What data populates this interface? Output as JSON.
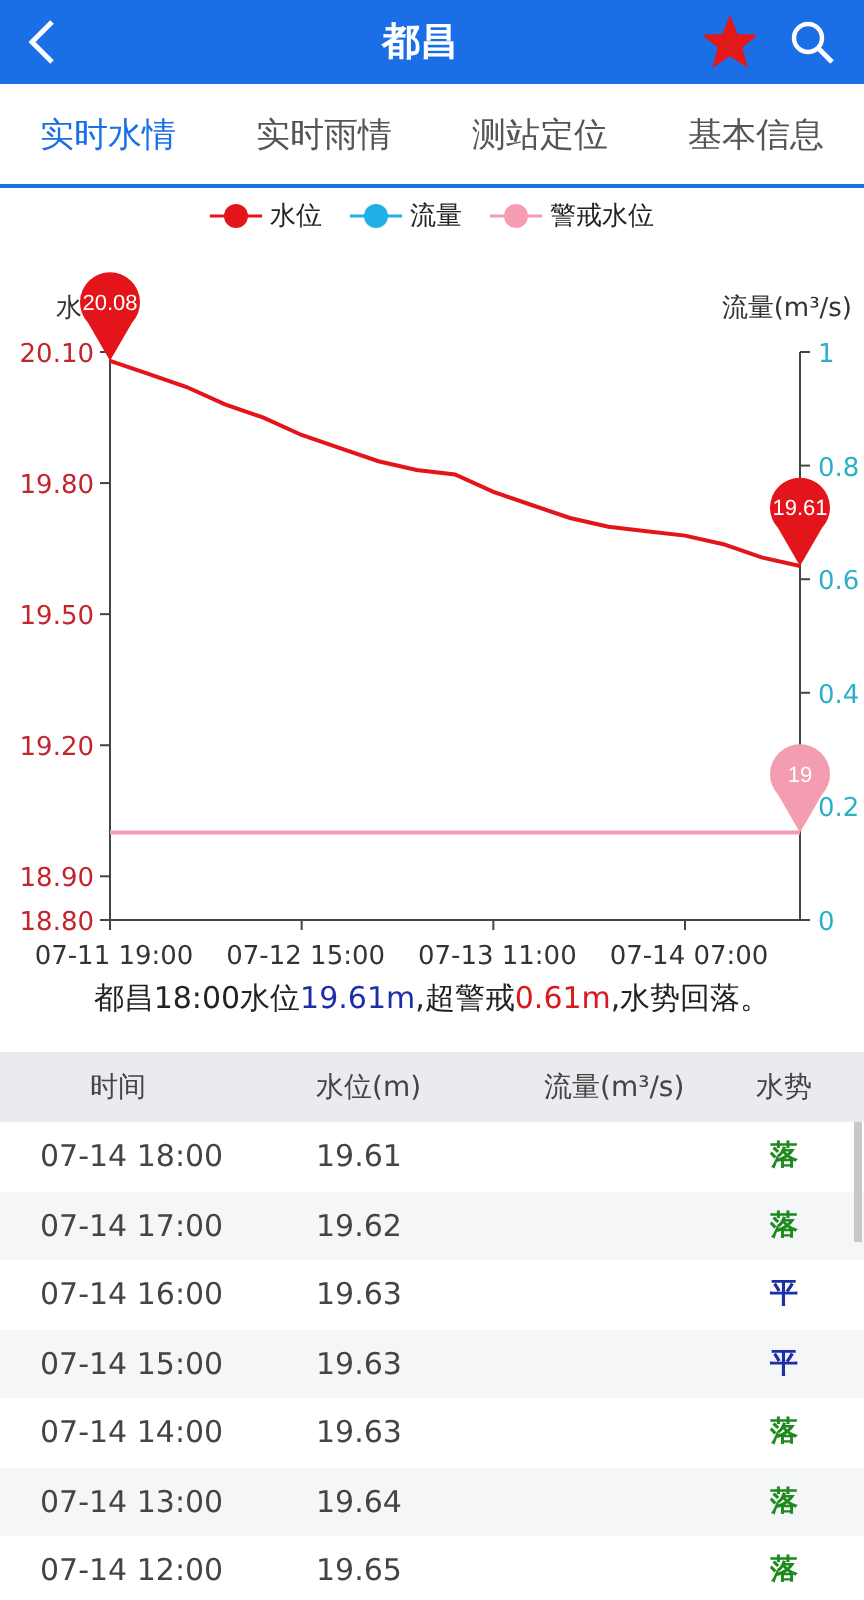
{
  "header": {
    "title": "都昌",
    "favorite": true
  },
  "tabs": [
    {
      "label": "实时水情",
      "selected": true
    },
    {
      "label": "实时雨情",
      "selected": false
    },
    {
      "label": "测站定位",
      "selected": false
    },
    {
      "label": "基本信息",
      "selected": false
    }
  ],
  "chart": {
    "chart_data": {
      "type": "line",
      "ylabel": "水",
      "y2label": "流量(m³/s)",
      "categories": [
        "07-11 19:00",
        null,
        null,
        null,
        null,
        "07-12 15:00",
        null,
        null,
        null,
        null,
        "07-13 11:00",
        null,
        null,
        null,
        null,
        "07-14 07:00",
        null,
        null,
        null
      ],
      "ylim": [
        18.8,
        20.1
      ],
      "y2lim": [
        0,
        1
      ],
      "yticks": [
        {
          "value": 20.1,
          "label": "20.10"
        },
        {
          "value": 19.8,
          "label": "19.80"
        },
        {
          "value": 19.5,
          "label": "19.50"
        },
        {
          "value": 19.2,
          "label": "19.20"
        },
        {
          "value": 18.9,
          "label": "18.90"
        },
        {
          "value": 18.8,
          "label": "18.80"
        }
      ],
      "y2ticks": [
        {
          "value": 1,
          "label": "1"
        },
        {
          "value": 0.8,
          "label": "0.8"
        },
        {
          "value": 0.6,
          "label": "0.6"
        },
        {
          "value": 0.4,
          "label": "0.4"
        },
        {
          "value": 0.2,
          "label": "0.2"
        },
        {
          "value": 0,
          "label": "0"
        }
      ],
      "series": [
        {
          "name": "水位",
          "color": "#e3151b",
          "values": [
            20.08,
            20.05,
            20.02,
            19.98,
            19.95,
            19.91,
            19.88,
            19.85,
            19.83,
            19.82,
            19.78,
            19.75,
            19.72,
            19.7,
            19.69,
            19.68,
            19.66,
            19.63,
            19.61
          ]
        },
        {
          "name": "流量",
          "color": "#1fb1e6",
          "values": [
            null,
            null,
            null,
            null,
            null,
            null,
            null,
            null,
            null,
            null,
            null,
            null,
            null,
            null,
            null,
            null,
            null,
            null,
            null
          ]
        },
        {
          "name": "警戒水位",
          "color": "#f49db0",
          "values": [
            19.0,
            19.0,
            19.0,
            19.0,
            19.0,
            19.0,
            19.0,
            19.0,
            19.0,
            19.0,
            19.0,
            19.0,
            19.0,
            19.0,
            19.0,
            19.0,
            19.0,
            19.0,
            19.0
          ]
        }
      ],
      "annotations": [
        {
          "text": "20.08",
          "y": 20.08
        },
        {
          "text": "19.61",
          "y": 19.61
        },
        {
          "text": "19",
          "y": 19.0
        }
      ]
    }
  },
  "summary": [
    {
      "text": "都昌18:00水位",
      "kind": "plain"
    },
    {
      "text": "19.61m",
      "kind": "level"
    },
    {
      "text": ",超警戒",
      "kind": "plain"
    },
    {
      "text": "0.61m",
      "kind": "excess"
    },
    {
      "text": ",水势回落。",
      "kind": "plain"
    }
  ],
  "table": {
    "columns": [
      "时间",
      "水位(m)",
      "流量(m³/s)",
      "水势"
    ],
    "rows": [
      {
        "time": "07-14 18:00",
        "level": "19.61",
        "trend": "落",
        "color": "#1e8a1e"
      },
      {
        "time": "07-14 17:00",
        "level": "19.62",
        "trend": "落",
        "color": "#1e8a1e"
      },
      {
        "time": "07-14 16:00",
        "level": "19.63",
        "trend": "平",
        "color": "#1c2ea8"
      },
      {
        "time": "07-14 15:00",
        "level": "19.63",
        "trend": "平",
        "color": "#1c2ea8"
      },
      {
        "time": "07-14 14:00",
        "level": "19.63",
        "trend": "落",
        "color": "#1e8a1e"
      },
      {
        "time": "07-14 13:00",
        "level": "19.64",
        "trend": "落",
        "color": "#1e8a1e"
      },
      {
        "time": "07-14 12:00",
        "level": "19.65",
        "trend": "落",
        "color": "#1e8a1e"
      }
    ]
  }
}
